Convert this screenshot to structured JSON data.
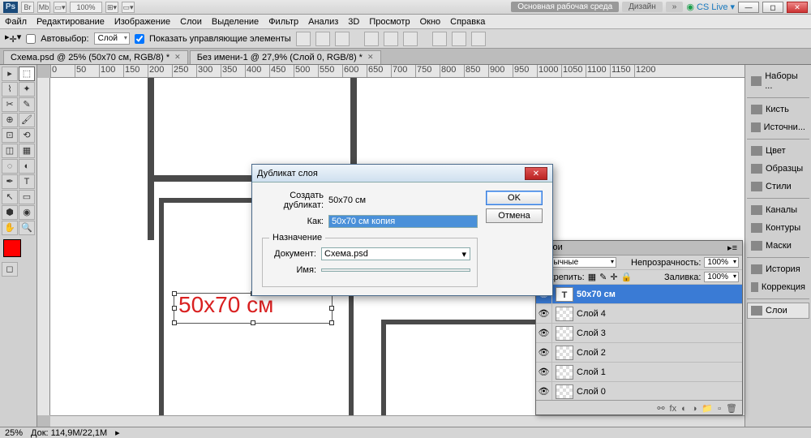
{
  "titlebar": {
    "workspace_primary": "Основная рабочая среда",
    "workspace_secondary": "Дизайн",
    "cslive": "CS Live",
    "zoom_label": "100%"
  },
  "menu": [
    "Файл",
    "Редактирование",
    "Изображение",
    "Слои",
    "Выделение",
    "Фильтр",
    "Анализ",
    "3D",
    "Просмотр",
    "Окно",
    "Справка"
  ],
  "optbar": {
    "autoselect": "Автовыбор:",
    "autoselect_mode": "Слой",
    "show_controls": "Показать управляющие элементы"
  },
  "tabs": [
    "Схема.psd @ 25% (50x70 см, RGB/8) *",
    "Без имени-1 @ 27,9% (Слой 0, RGB/8) *"
  ],
  "canvas": {
    "text": "50х70 см"
  },
  "dialog": {
    "title": "Дубликат слоя",
    "duplicate_label": "Создать дубликат:",
    "duplicate_value": "50x70 см",
    "as_label": "Как:",
    "as_value": "50x70 см копия",
    "dest_group": "Назначение",
    "doc_label": "Документ:",
    "doc_value": "Схема.psd",
    "name_label": "Имя:",
    "name_value": "",
    "ok": "OK",
    "cancel": "Отмена"
  },
  "rightpanels": {
    "sets": "Наборы ...",
    "brush": "Кисть",
    "sources": "Источни...",
    "color": "Цвет",
    "swatches": "Образцы",
    "styles": "Стили",
    "channels": "Каналы",
    "paths": "Контуры",
    "masks": "Маски",
    "history": "История",
    "adjustments": "Коррекция",
    "layers": "Слои"
  },
  "layerspanel": {
    "tab": "Слои",
    "blend": "Обычные",
    "opacity_label": "Непрозрачность:",
    "opacity_value": "100%",
    "lock_label": "Закрепить:",
    "fill_label": "Заливка:",
    "fill_value": "100%",
    "layers": [
      {
        "name": "50x70 см",
        "type": "T",
        "selected": true
      },
      {
        "name": "Слой 4",
        "type": "px"
      },
      {
        "name": "Слой 3",
        "type": "px"
      },
      {
        "name": "Слой 2",
        "type": "px"
      },
      {
        "name": "Слой 1",
        "type": "px"
      },
      {
        "name": "Слой 0",
        "type": "bg"
      }
    ]
  },
  "status": {
    "zoom": "25%",
    "doc": "Док: 114,9M/22,1M"
  },
  "ruler_ticks": [
    "0",
    "50",
    "100",
    "150",
    "200",
    "250",
    "300",
    "350",
    "400",
    "450",
    "500",
    "550",
    "600",
    "650",
    "700",
    "750",
    "800",
    "850",
    "900",
    "950",
    "1000",
    "1050",
    "1100",
    "1150",
    "1200"
  ]
}
